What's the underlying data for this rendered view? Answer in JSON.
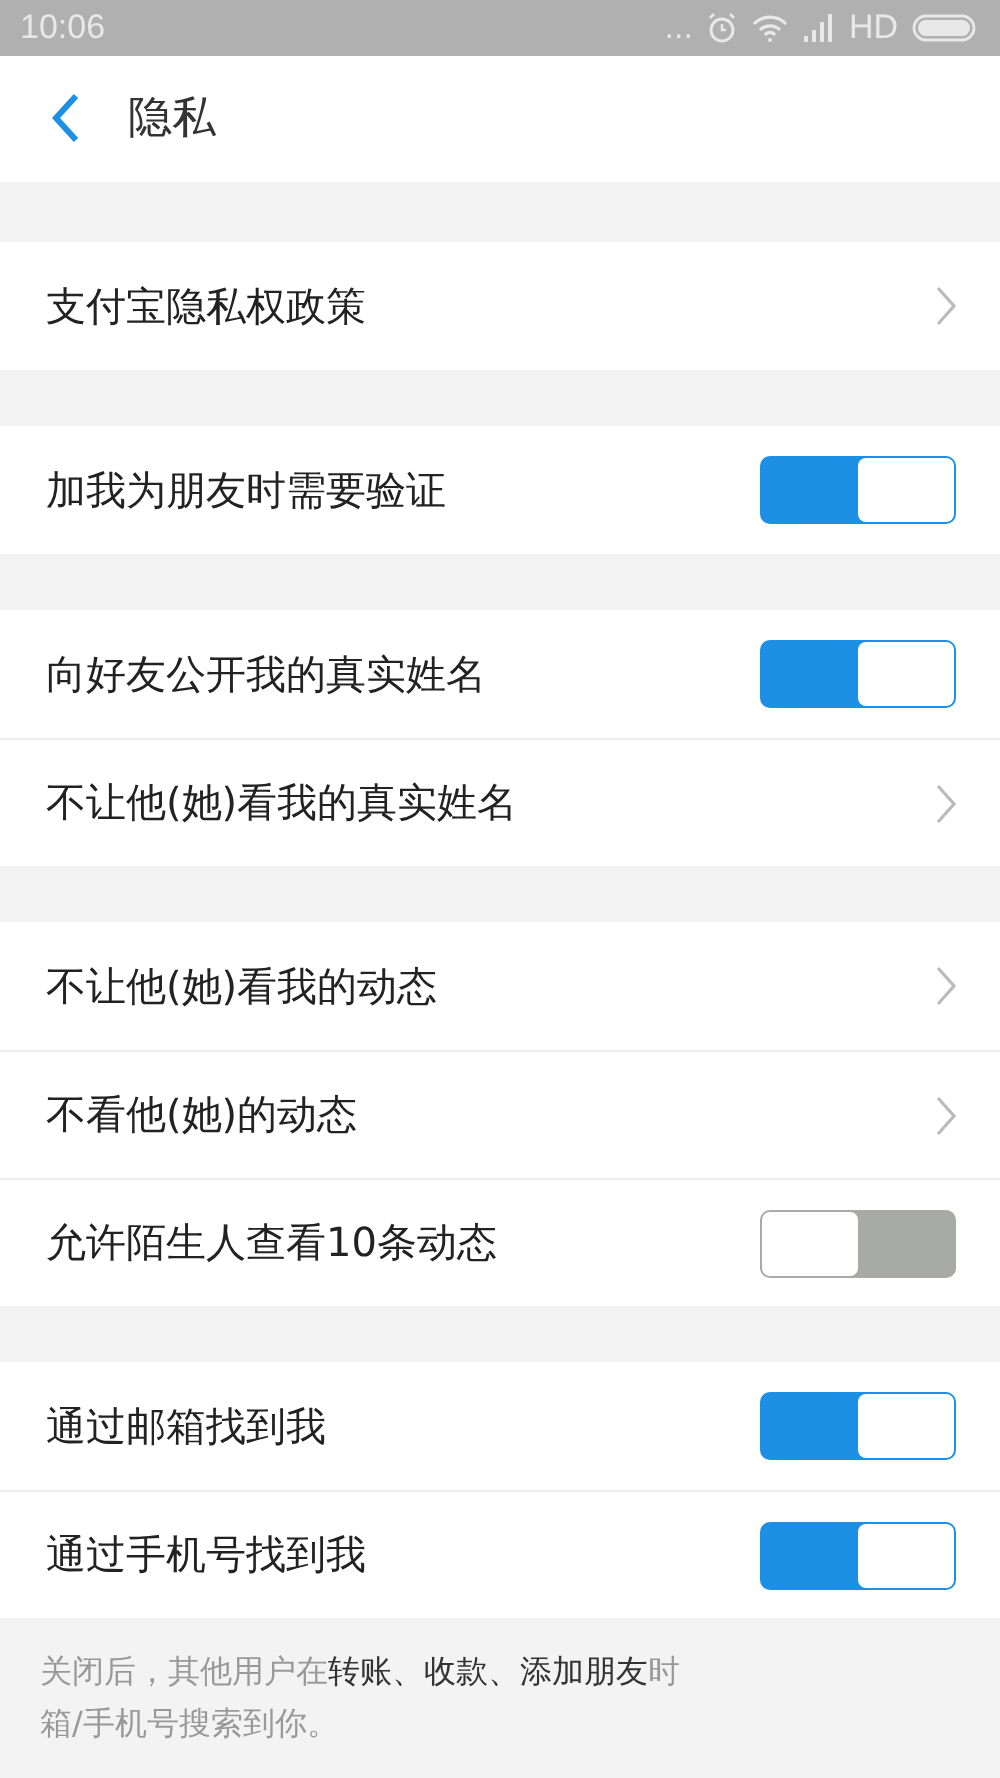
{
  "status_bar": {
    "time": "10:06",
    "dots": "...",
    "network": "HD"
  },
  "header": {
    "title": "隐私"
  },
  "sections": [
    {
      "items": [
        {
          "kind": "link",
          "label": "支付宝隐私权政策"
        }
      ]
    },
    {
      "items": [
        {
          "kind": "toggle",
          "label": "加我为朋友时需要验证",
          "on": true
        }
      ]
    },
    {
      "items": [
        {
          "kind": "toggle",
          "label": "向好友公开我的真实姓名",
          "on": true
        },
        {
          "kind": "link",
          "label": "不让他(她)看我的真实姓名"
        }
      ]
    },
    {
      "items": [
        {
          "kind": "link",
          "label": "不让他(她)看我的动态"
        },
        {
          "kind": "link",
          "label": "不看他(她)的动态"
        },
        {
          "kind": "toggle",
          "label": "允许陌生人查看10条动态",
          "on": false
        }
      ]
    },
    {
      "items": [
        {
          "kind": "toggle",
          "label": "通过邮箱找到我",
          "on": true
        },
        {
          "kind": "toggle",
          "label": "通过手机号找到我",
          "on": true
        }
      ]
    }
  ],
  "footer": {
    "lines": [
      "关闭后，其他用户在**转账、收款、添加朋友**时",
      "箱/手机号搜索到你。"
    ]
  }
}
